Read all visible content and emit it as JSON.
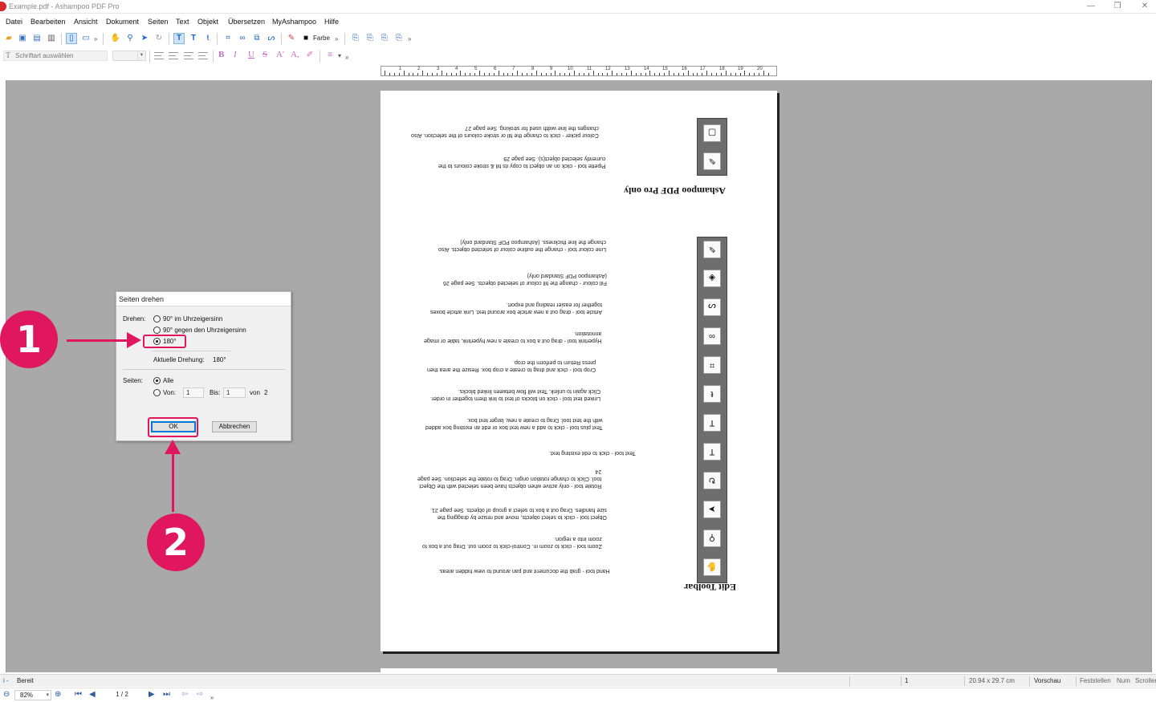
{
  "window": {
    "title": "Example.pdf - Ashampoo PDF Pro",
    "minimize": "—",
    "maximize": "❐",
    "close": "✕"
  },
  "menu": [
    "Datei",
    "Bearbeiten",
    "Ansicht",
    "Dokument",
    "Seiten",
    "Text",
    "Objekt",
    "Übersetzen",
    "MyAshampoo",
    "Hilfe"
  ],
  "toolbar": {
    "color_label": "Farbe",
    "font_placeholder": "Schriftart auswählen",
    "format_buttons": [
      "B",
      "I",
      "U",
      "S",
      "A'",
      "A,"
    ]
  },
  "ruler": {
    "numbers": [
      "1",
      "2",
      "3",
      "4",
      "5",
      "6",
      "7",
      "8",
      "9",
      "10",
      "11",
      "12",
      "13",
      "14",
      "15",
      "16",
      "17",
      "18",
      "19",
      "20"
    ]
  },
  "pdf_page": {
    "heading_pro": "Ashampoo PDF Pro only",
    "heading_edit": "Edit Toolbar",
    "entries": [
      {
        "label": "Colour picker",
        "lines": [
          "Colour picker  -  click to change the fill or stroke colours of the selection. Also",
          "changes the line width used for stroking. See page 27"
        ]
      },
      {
        "label": "Pipette tool",
        "lines": [
          "Pipette tool  -  click on an object to copy its fill & stroke colours to the",
          "currently selected object(s). See page 29"
        ]
      },
      {
        "label": "Line colour tool",
        "lines": [
          "Line colour tool  -  change the outline colour of selected objects. Also",
          "change the line thickness. (Ashampoo PDF Standard only)"
        ]
      },
      {
        "label": "Fill colour",
        "lines": [
          "Fill colour  -  change the fill colour of selected objects. See page 26",
          "(Ashampoo PDF Standard only)"
        ]
      },
      {
        "label": "Article tool",
        "lines": [
          "Article tool  -  drag out a new article box around text. Link article boxes",
          "together for easier reading and export."
        ]
      },
      {
        "label": "Hyperlink tool",
        "lines": [
          "Hyperlink tool  -  drag out a box to create a new hyperlink, table or image",
          "annotation."
        ]
      },
      {
        "label": "Crop tool",
        "lines": [
          "Crop tool  -  click and drag to create a crop box. Resize the area then",
          "press Return to perform the crop."
        ]
      },
      {
        "label": "Linked text tool",
        "lines": [
          "Linked text tool  -  click on blocks of text to link them together in order.",
          "Click again to unlink. Text will flow between linked blocks."
        ]
      },
      {
        "label": "Text plus tool",
        "lines": [
          "Text plus tool  -  click to add a new text box or edit an existing box added",
          "with the text tool. Drag to create a new, larger text box."
        ]
      },
      {
        "label": "Text tool",
        "lines": [
          "Text tool  -  click to edit existing text."
        ]
      },
      {
        "label": "Rotate tool",
        "lines": [
          "Rotate tool  -  only active when objects have been selected with the Object",
          "tool. Click to change rotation origin. Drag to rotate the selection. See page",
          "24"
        ]
      },
      {
        "label": "Object tool",
        "lines": [
          "Object tool  -  click to select objects, move and resize by dragging the",
          "size handles. Drag out a box to select a group of objects. See page 21."
        ]
      },
      {
        "label": "Zoom tool",
        "lines": [
          "Zoom tool  -  click to zoom in. Control-click to zoom out. Drag out a box to",
          "zoom into a region."
        ]
      },
      {
        "label": "Hand tool",
        "lines": [
          "Hand tool  -  grab the document and pan around to view hidden areas."
        ]
      }
    ]
  },
  "dialog": {
    "title": "Seiten drehen",
    "rotate_label": "Drehen:",
    "options": [
      "90° im Uhrzeigersinn",
      "90° gegen den Uhrzeigersinn",
      "180°"
    ],
    "selected_option": "180°",
    "current_rotation_label": "Aktuelle Drehung:",
    "current_rotation_value": "180°",
    "pages_label": "Seiten:",
    "pages_all": "Alle",
    "pages_from": "Von:",
    "from_value": "1",
    "to_label": "Bis:",
    "to_value": "1",
    "of_label": "von",
    "of_value": "2",
    "ok": "OK",
    "cancel": "Abbrechen"
  },
  "annotations": {
    "step1": "1",
    "step2": "2",
    "color": "#e0175f"
  },
  "status": {
    "ready": "Bereit",
    "page_number": "1",
    "page_size": "20.94 x 29.7 cm",
    "mode": "Vorschau",
    "caps": "Feststellen",
    "num": "Num",
    "scroll": "Scrollen"
  },
  "navigation": {
    "zoom": "82%",
    "page_indicator": "1 / 2"
  }
}
